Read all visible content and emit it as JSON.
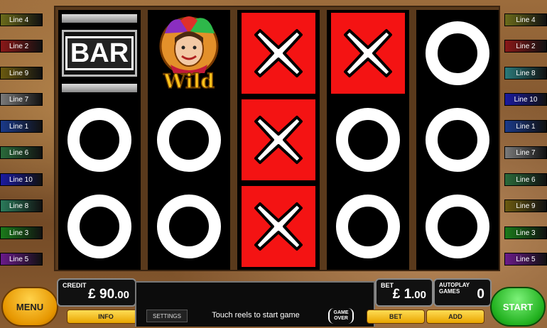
{
  "paylines_left": [
    {
      "label": "Line 4",
      "color": "#6b6b1a"
    },
    {
      "label": "Line 2",
      "color": "#8a1818"
    },
    {
      "label": "Line 9",
      "color": "#6b5a10"
    },
    {
      "label": "Line 7",
      "color": "#7a7a7a"
    },
    {
      "label": "Line 1",
      "color": "#1a3a8a"
    },
    {
      "label": "Line 6",
      "color": "#2a6a3a"
    },
    {
      "label": "Line 10",
      "color": "#1a1aa0"
    },
    {
      "label": "Line 8",
      "color": "#2a7a5a"
    },
    {
      "label": "Line 3",
      "color": "#1a7a1a"
    },
    {
      "label": "Line 5",
      "color": "#6a1a8a"
    }
  ],
  "paylines_right": [
    {
      "label": "Line 4",
      "color": "#6b6b1a"
    },
    {
      "label": "Line 2",
      "color": "#8a1818"
    },
    {
      "label": "Line 8",
      "color": "#2a7a7a"
    },
    {
      "label": "Line 10",
      "color": "#1a1aa0"
    },
    {
      "label": "Line 1",
      "color": "#1a3a8a"
    },
    {
      "label": "Line 7",
      "color": "#7a7a7a"
    },
    {
      "label": "Line 6",
      "color": "#2a6a3a"
    },
    {
      "label": "Line 9",
      "color": "#6b5a10"
    },
    {
      "label": "Line 3",
      "color": "#1a7a1a"
    },
    {
      "label": "Line 5",
      "color": "#6a1a8a"
    }
  ],
  "reels": [
    [
      "bar",
      "o",
      "o"
    ],
    [
      "wild",
      "o",
      "o"
    ],
    [
      "x",
      "x",
      "x"
    ],
    [
      "x",
      "o",
      "o"
    ],
    [
      "o",
      "o",
      "o"
    ]
  ],
  "symbols": {
    "bar_text": "BAR",
    "wild_text": "Wild"
  },
  "controls": {
    "menu": "MENU",
    "start": "START",
    "info": "INFO",
    "settings": "SETTINGS",
    "bet_btn": "BET",
    "add_btn": "ADD",
    "message": "Touch reels to start game",
    "game_over_line1": "GAME",
    "game_over_line2": "OVER"
  },
  "credit": {
    "label": "CREDIT",
    "currency": "£",
    "whole": "90",
    "decimal": ".00"
  },
  "bet": {
    "label": "BET",
    "currency": "£",
    "whole": "1",
    "decimal": ".00"
  },
  "autoplay": {
    "label": "AUTOPLAY GAMES",
    "value": "0"
  }
}
